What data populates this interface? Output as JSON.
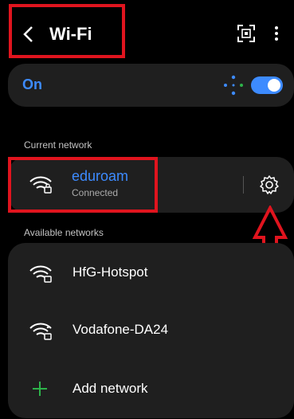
{
  "header": {
    "back_icon": "chevron-left-icon",
    "title": "Wi-Fi",
    "qr_icon": "qr-scan-icon",
    "more_icon": "more-vertical-icon"
  },
  "master_toggle": {
    "label": "On",
    "state": true,
    "scan_icon": "wifi-scan-dots-icon"
  },
  "current_network": {
    "section_label": "Current network",
    "name": "eduroam",
    "status": "Connected",
    "settings_icon": "gear-icon"
  },
  "available_networks": {
    "section_label": "Available networks",
    "items": [
      {
        "name": "HfG-Hotspot",
        "icon": "wifi-icon"
      },
      {
        "name": "Vodafone-DA24",
        "icon": "wifi-locked-icon"
      }
    ],
    "add_label": "Add network"
  },
  "colors": {
    "accent": "#3d8bff",
    "annotation": "#e0141e",
    "card": "#1f1f1f",
    "add_plus": "#2db34a"
  }
}
